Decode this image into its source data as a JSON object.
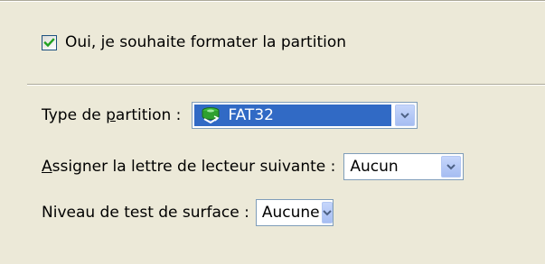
{
  "format_option": {
    "checked": true,
    "label": "Oui, je souhaite formater la partition"
  },
  "partition_type": {
    "label_before": "Type de ",
    "label_mnemonic": "p",
    "label_after": "artition :",
    "value": "FAT32",
    "icon": "partition-icon"
  },
  "drive_letter": {
    "label_mnemonic": "A",
    "label_after": "ssigner la lettre de lecteur suivante :",
    "value": "Aucun"
  },
  "surface_test": {
    "label": "Niveau de test de surface :",
    "value": "Aucune"
  },
  "colors": {
    "background": "#ece9d8",
    "selection": "#316ac5",
    "check": "#21a121",
    "field_border": "#7f9db9"
  }
}
